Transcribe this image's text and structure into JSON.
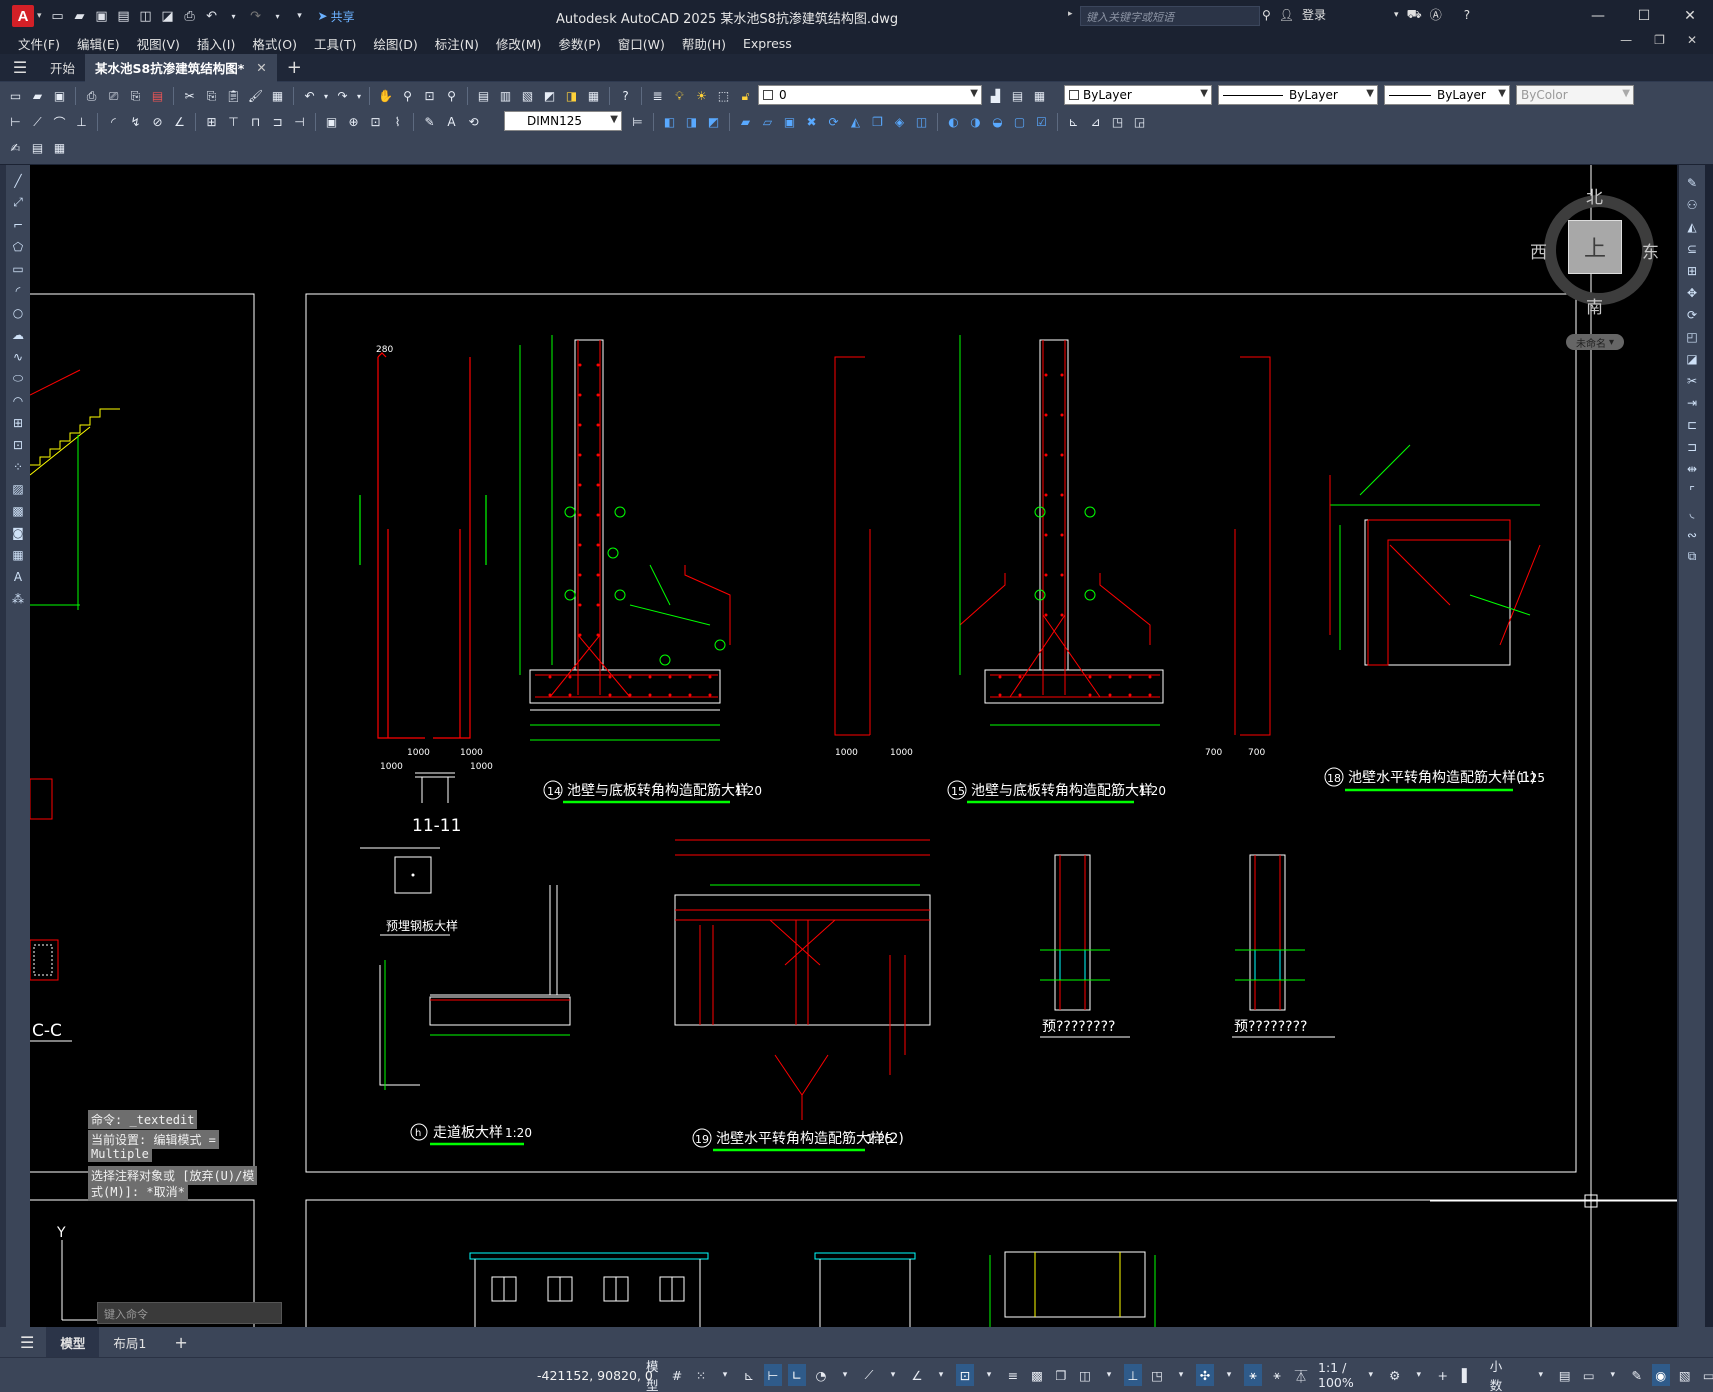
{
  "titlebar": {
    "logo": "A",
    "share": "共享",
    "app_title": "Autodesk AutoCAD 2025    某水池S8抗渗建筑结构图.dwg",
    "search_placeholder": "键入关键字或短语",
    "login": "登录"
  },
  "menu": [
    "文件(F)",
    "编辑(E)",
    "视图(V)",
    "插入(I)",
    "格式(O)",
    "工具(T)",
    "绘图(D)",
    "标注(N)",
    "修改(M)",
    "参数(P)",
    "窗口(W)",
    "帮助(H)",
    "Express"
  ],
  "filetabs": {
    "start": "开始",
    "active": "某水池S8抗渗建筑结构图*",
    "close": "✕",
    "add": "+"
  },
  "toolbar": {
    "layer_value": "0",
    "dim_style": "DIMN125",
    "color": "ByLayer",
    "linetype": "ByLayer",
    "lineweight": "ByLayer",
    "plotstyle": "ByColor"
  },
  "viewcube": {
    "north": "北",
    "south": "南",
    "east": "东",
    "west": "西",
    "face": "上",
    "wcs": "未命名"
  },
  "command": {
    "line1": "命令: _textedit",
    "line2a": "当前设置: 编辑模式 =",
    "line2b": "Multiple",
    "line3a": "选择注释对象或 [放弃(U)/模",
    "line3b": "式(M)]: *取消*",
    "input_placeholder": "键入命令"
  },
  "drawing": {
    "title14": "池壁与底板转角构造配筋大样",
    "scale14": "1:20",
    "num14": "14",
    "title15": "池壁与底板转角构造配筋大样",
    "scale15": "1:20",
    "num15": "15",
    "title18": "池壁水平转角构造配筋大样(1)",
    "scale18": "1:25",
    "num18": "18",
    "title19": "池壁水平转角构造配筋大样(2)",
    "scale19": "1:25",
    "num19": "19",
    "titleh": "走道板大样",
    "scaleh": "1:20",
    "numh": "h",
    "section11": "11-11",
    "sectionCC": "C-C",
    "embed": "预埋钢板大样",
    "unknown1": "预????????",
    "unknown2": "预????????",
    "dim280": "280",
    "dim1000a": "1000",
    "dim1000b": "1000",
    "dim1000c": "1000",
    "dim1000d": "1000",
    "dim700a": "700",
    "dim700b": "700",
    "dim1000e": "1000",
    "dim1000f": "1000"
  },
  "layouttabs": {
    "model": "模型",
    "layout1": "布局1",
    "add": "+"
  },
  "status": {
    "coords": "-421152, 90820, 0",
    "model": "模型",
    "scale": "1:1 / 100%",
    "units": "小数"
  }
}
